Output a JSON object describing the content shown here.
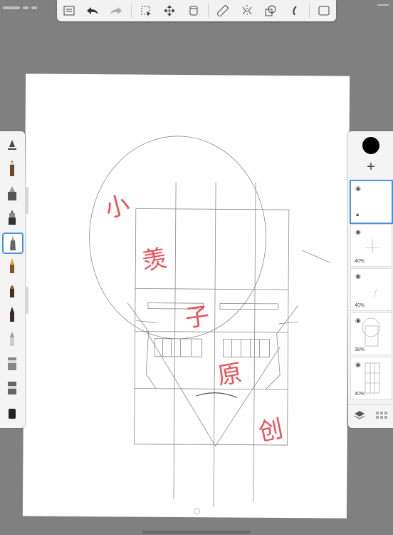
{
  "toolbar": {
    "items": [
      {
        "name": "gallery-icon"
      },
      {
        "name": "undo-icon"
      },
      {
        "name": "redo-icon"
      },
      {
        "name": "selection-icon"
      },
      {
        "name": "transform-icon"
      },
      {
        "name": "crop-icon"
      },
      {
        "name": "ruler-icon"
      },
      {
        "name": "symmetry-icon"
      },
      {
        "name": "shapes-icon"
      },
      {
        "name": "curve-icon"
      },
      {
        "name": "fullscreen-icon"
      }
    ]
  },
  "watermark": {
    "chars": [
      "小",
      "羡",
      "子",
      "原",
      "创"
    ],
    "color": "#e8525a"
  },
  "brushes": [
    "brush-settings-icon",
    "pencil-icon",
    "marker-icon",
    "airbrush-icon",
    "fineliner-icon",
    "ink-pen-icon",
    "paint-brush-icon",
    "chisel-brush-icon",
    "soft-brush-icon",
    "smudge-icon",
    "eraser-icon",
    "fill-icon"
  ],
  "selected_brush_index": 4,
  "layers": {
    "color": "#000000",
    "add_label": "+",
    "items": [
      {
        "opacity": "",
        "selected": true
      },
      {
        "opacity": "40%",
        "selected": false
      },
      {
        "opacity": "40%",
        "selected": false
      },
      {
        "opacity": "38%",
        "selected": false
      },
      {
        "opacity": "40%",
        "selected": false
      }
    ]
  }
}
